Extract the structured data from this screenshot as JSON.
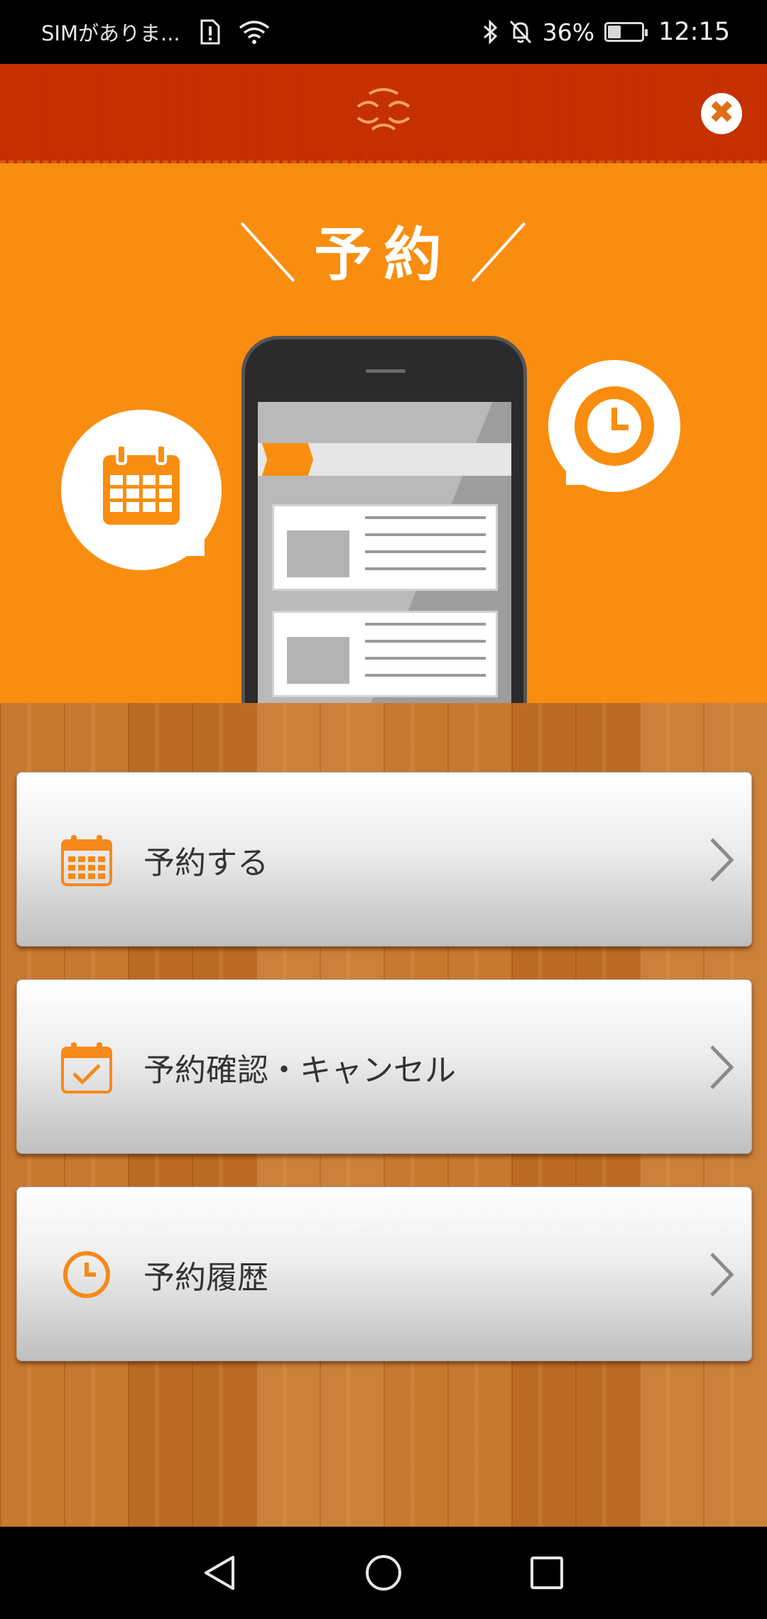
{
  "status_bar": {
    "carrier": "SIMがありま...",
    "battery_percent": "36%",
    "battery_level": 0.36,
    "time": "12:15"
  },
  "header": {
    "title": "予約",
    "close_label": "✖"
  },
  "menu": {
    "items": [
      {
        "label": "予約する",
        "icon": "calendar-icon"
      },
      {
        "label": "予約確認・キャンセル",
        "icon": "calendar-check-icon"
      },
      {
        "label": "予約履歴",
        "icon": "clock-icon"
      }
    ]
  },
  "colors": {
    "accent": "#f98d0f",
    "header_band": "#e06e17",
    "wood": "#c47530"
  },
  "nav_bar": {
    "icons": [
      "back-icon",
      "home-icon",
      "recents-icon"
    ]
  }
}
